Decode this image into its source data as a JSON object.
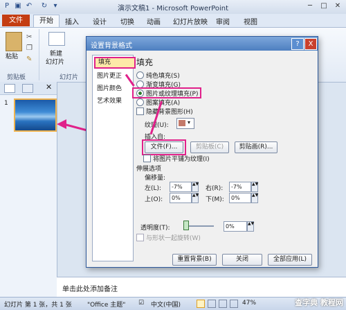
{
  "app": {
    "title": "演示文稿1 - Microsoft PowerPoint"
  },
  "ribbon_tabs": [
    "文件",
    "开始",
    "插入",
    "设计",
    "切换",
    "动画",
    "幻灯片放映",
    "审阅",
    "视图"
  ],
  "ribbon": {
    "paste": "粘贴",
    "new_slide": "新建",
    "slide_dropdown": "幻灯片",
    "clipboard_group": "剪贴板",
    "slides_group": "幻灯片"
  },
  "slide_panel": {
    "slide_number": "1"
  },
  "notes_placeholder": "单击此处添加备注",
  "status": {
    "slide_info": "幻灯片 第 1 张，共 1 张",
    "theme": "\"Office 主题\"",
    "language": "中文(中国)",
    "zoom": "47%"
  },
  "dialog": {
    "title": "设置背景格式",
    "help": "?",
    "close": "X",
    "nav": [
      "填充",
      "图片更正",
      "图片颜色",
      "艺术效果"
    ],
    "section_title": "填充",
    "fill_options": [
      "纯色填充(S)",
      "渐变填充(G)",
      "图片或纹理填充(P)",
      "图案填充(A)"
    ],
    "hide_bg": "隐藏背景图形(H)",
    "texture_label": "纹理(U):",
    "insert_from": "插入自:",
    "file_btn": "文件(F)...",
    "clipboard_btn": "剪贴板(C)",
    "clipart_btn": "剪贴画(R)...",
    "tile_label": "将图片平铺为纹理(I)",
    "stretch_label": "伸展选项",
    "offset_label": "偏移量:",
    "left_label": "左(L):",
    "left_val": "-7%",
    "right_label": "右(R):",
    "right_val": "-7%",
    "top_label": "上(O):",
    "top_val": "0%",
    "bottom_label": "下(M):",
    "bottom_val": "0%",
    "transparency_label": "透明度(T):",
    "transparency_val": "0%",
    "rotate_label": "与形状一起旋转(W)",
    "reset_btn": "重置背景(B)",
    "close_btn": "关闭",
    "apply_all_btn": "全部应用(L)"
  },
  "watermark": "查字典 教程网",
  "colors": {
    "file_tab": "#c43d12",
    "highlight": "#e0218a",
    "dialog_title": "#4d7fc0"
  }
}
